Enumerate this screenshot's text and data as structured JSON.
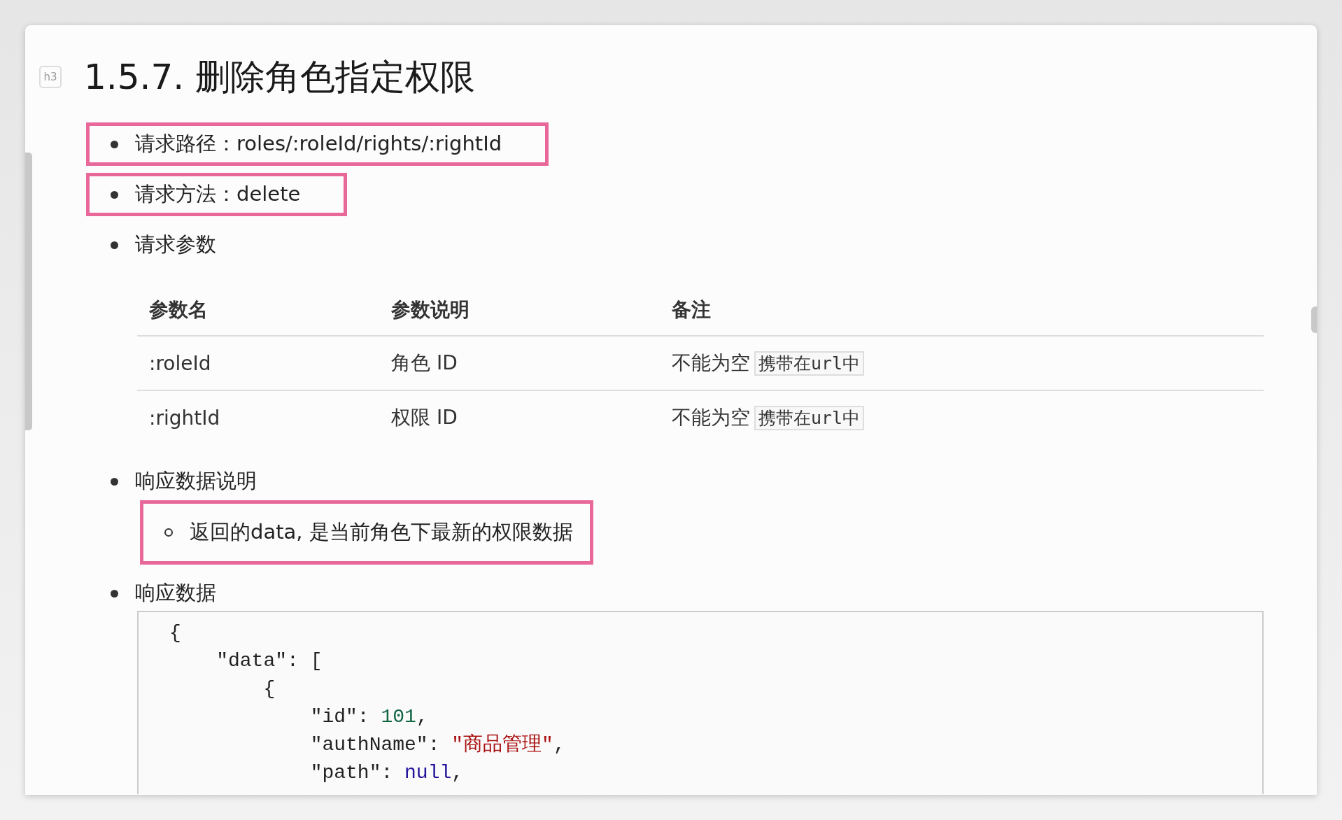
{
  "heading": {
    "badge": "h3",
    "title": "1.5.7. 删除角色指定权限"
  },
  "items": [
    {
      "kind": "text",
      "text": "请求路径：roles/:roleId/rights/:rightId",
      "highlighted": true
    },
    {
      "kind": "text",
      "text": "请求方法：delete",
      "highlighted": true
    },
    {
      "kind": "table",
      "text": "请求参数",
      "highlighted": false,
      "table": {
        "columns": [
          "参数名",
          "参数说明",
          "备注"
        ],
        "rows": [
          {
            "name": ":roleId",
            "desc": "角色 ID",
            "note": "不能为空",
            "note_code": "携带在url中"
          },
          {
            "name": ":rightId",
            "desc": "权限 ID",
            "note": "不能为空",
            "note_code": "携带在url中"
          }
        ]
      }
    },
    {
      "kind": "text",
      "text": "响应数据说明",
      "highlighted": false,
      "children": [
        {
          "text": "返回的data, 是当前角色下最新的权限数据",
          "highlighted": true
        }
      ]
    },
    {
      "kind": "code",
      "text": "响应数据",
      "highlighted": false,
      "code": [
        [
          {
            "kind": "plain",
            "text": "{"
          }
        ],
        [
          {
            "kind": "plain",
            "text": "    \"data\": ["
          }
        ],
        [
          {
            "kind": "plain",
            "text": "        {"
          }
        ],
        [
          {
            "kind": "plain",
            "text": "            \"id\": "
          },
          {
            "kind": "number",
            "text": "101"
          },
          {
            "kind": "plain",
            "text": ","
          }
        ],
        [
          {
            "kind": "plain",
            "text": "            \"authName\": "
          },
          {
            "kind": "string",
            "text": "\"商品管理\""
          },
          {
            "kind": "plain",
            "text": ","
          }
        ],
        [
          {
            "kind": "plain",
            "text": "            \"path\": "
          },
          {
            "kind": "null",
            "text": "null"
          },
          {
            "kind": "plain",
            "text": ","
          }
        ]
      ]
    }
  ]
}
